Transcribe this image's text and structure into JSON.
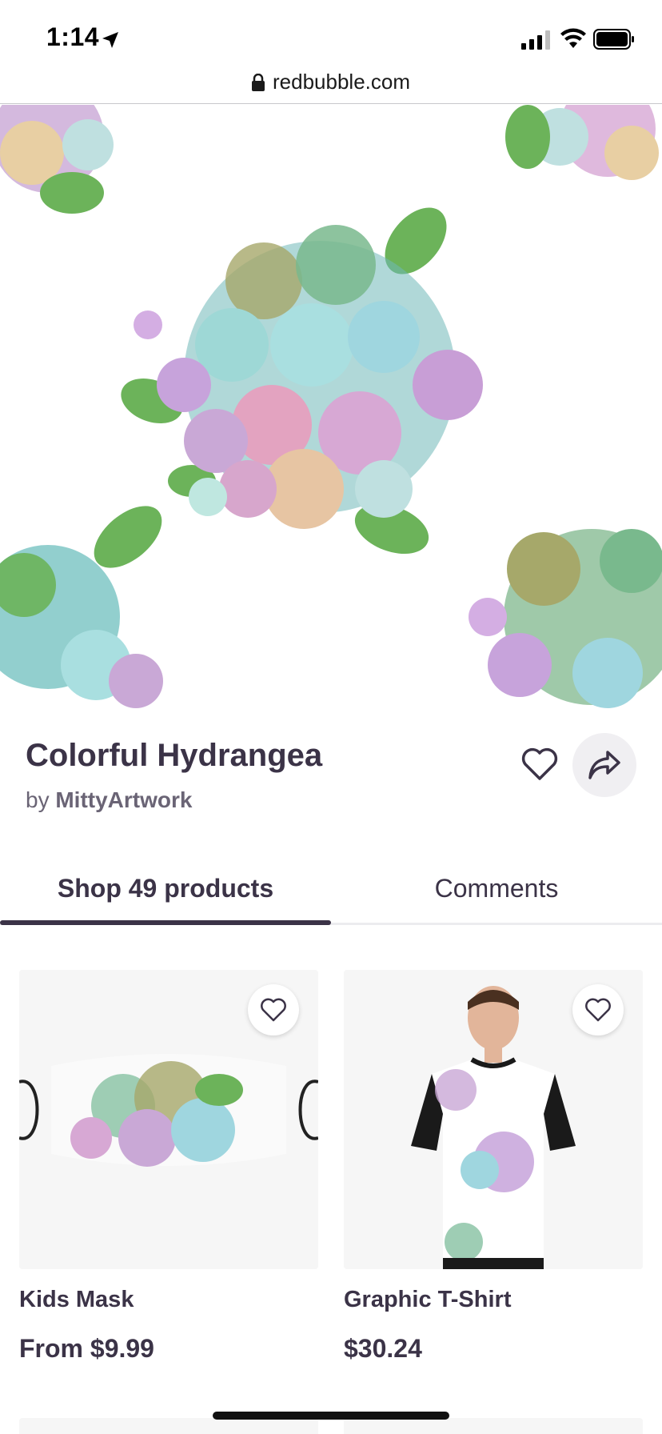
{
  "status_bar": {
    "time": "1:14",
    "icons": [
      "location-arrow-icon",
      "signal-icon",
      "wifi-icon",
      "battery-icon"
    ]
  },
  "browser": {
    "url": "redbubble.com",
    "lock_icon": "lock-icon"
  },
  "artwork": {
    "title": "Colorful Hydrangea",
    "by_prefix": "by",
    "artist": "MittyArtwork",
    "favorite_icon": "heart-icon",
    "share_icon": "share-arrow-icon"
  },
  "tabs": [
    {
      "label": "Shop 49 products",
      "active": true
    },
    {
      "label": "Comments",
      "active": false
    }
  ],
  "products": [
    {
      "name": "Kids Mask",
      "price": "From $9.99",
      "favorite_icon": "heart-icon"
    },
    {
      "name": "Graphic T-Shirt",
      "price": "$30.24",
      "favorite_icon": "heart-icon"
    }
  ],
  "colors": {
    "text_primary": "#3b3347",
    "text_secondary": "#6a6475",
    "tab_underline": "#3b3347",
    "share_bg": "#f0eff2",
    "card_bg": "#f6f6f6"
  }
}
